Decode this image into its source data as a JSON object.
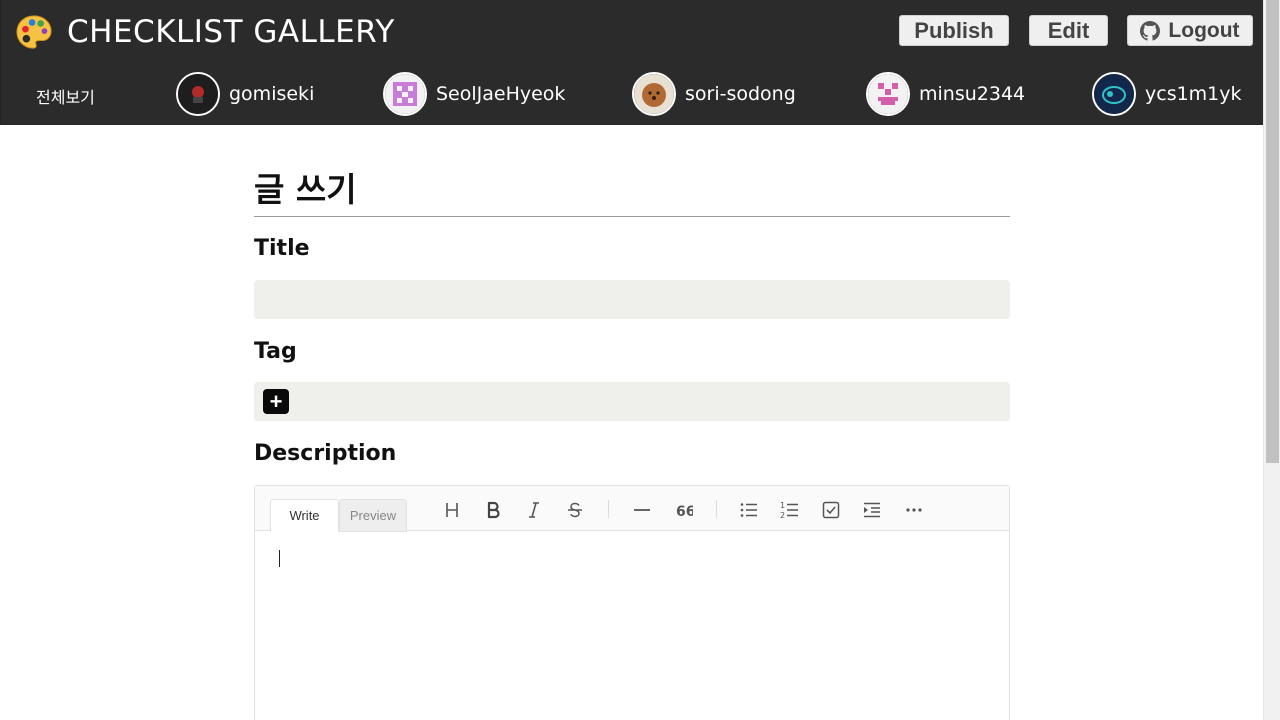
{
  "header": {
    "brand": "CHECKLIST GALLERY",
    "buttons": {
      "publish": "Publish",
      "edit": "Edit",
      "logout": "Logout"
    }
  },
  "userbar": {
    "all_label": "전체보기",
    "users": [
      {
        "name": "gomiseki"
      },
      {
        "name": "SeolJaeHyeok"
      },
      {
        "name": "sori-sodong"
      },
      {
        "name": "minsu2344"
      },
      {
        "name": "ycs1m1yk"
      }
    ]
  },
  "form": {
    "page_title": "글 쓰기",
    "title_label": "Title",
    "title_value": "",
    "tag_label": "Tag",
    "description_label": "Description"
  },
  "editor": {
    "tabs": {
      "write": "Write",
      "preview": "Preview"
    },
    "content": ""
  },
  "colors": {
    "header_bg": "#2b2b2b",
    "field_bg": "#efefec",
    "button_bg": "#efefef"
  }
}
